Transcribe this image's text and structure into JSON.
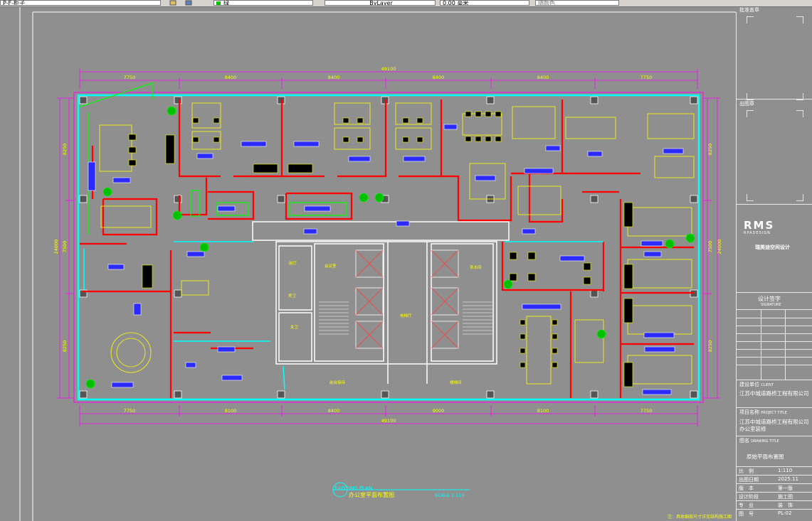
{
  "toolbar": {
    "layer_value": "P-F-柜子",
    "color_value": "绿",
    "linetype_value": "ByLayer",
    "lineweight_value": "0.00 毫米",
    "plotstyle_value": "随颜色"
  },
  "plan": {
    "dim_total_top": "49100",
    "dim_total_bottom": "49100",
    "dims_top": [
      "7750",
      "8400",
      "8400",
      "8400",
      "8400",
      "7750"
    ],
    "dims_bottom": [
      "7750",
      "8100",
      "8400",
      "9000",
      "8100",
      "7750"
    ],
    "dims_left": [
      "8250",
      "7500",
      "8250"
    ],
    "dims_left_total": "24000",
    "dims_right": [
      "8250",
      "7500",
      "8250"
    ],
    "dims_right_total": "24000",
    "room_labels": [
      "前厅",
      "会议室",
      "男卫",
      "女卫",
      "前台接待",
      "电梯厅",
      "茶水间",
      "楼梯间"
    ],
    "colors": {
      "background": "#8f8f8f",
      "outer_wall": "#00ffff",
      "partition": "#ff0000",
      "furniture": "#ffff00",
      "dimension": "#ff00ff",
      "label_box": "#0000ff",
      "plant": "#00ff00",
      "white_line": "#ffffff"
    }
  },
  "sheet": {
    "caption": "EXISTING PLAN",
    "title": "办公室平面布置图",
    "scale": "SCALE 1:110",
    "note": "注：具体细部尺寸详见结构施工图"
  },
  "titleblock": {
    "approve_stamp": "批准盖章",
    "issue_stamp": "出图章",
    "logo": "RMS",
    "logo_sub": "RPADESIGN",
    "brand_cn": "瑞美迪空间设计",
    "sign_heading": "设计签字",
    "sign_heading_en": "SIGNATURE",
    "client_label": "建设单位",
    "client_label_en": "CLIENT",
    "client_name": "江苏中城道路桥工程有限公司",
    "project_label": "项目名称",
    "project_label_en": "PROJECT TITLE",
    "project_name": "江苏中城道路桥工程有限公司办公室装修",
    "drawing_label": "图名",
    "drawing_label_en": "DRAWING TITLE",
    "drawing_name": "原始平面布置图",
    "scale_k": "比　例",
    "scale_v": "1:110",
    "date_k": "出图日期",
    "date_v": "2025.11",
    "version_k": "版　本",
    "version_v": "第一版",
    "stage_k": "设计阶段",
    "stage_v": "施工图",
    "major_k": "专　业",
    "major_v": "装　饰",
    "num_k": "图　号",
    "num_v": "PL-02"
  }
}
